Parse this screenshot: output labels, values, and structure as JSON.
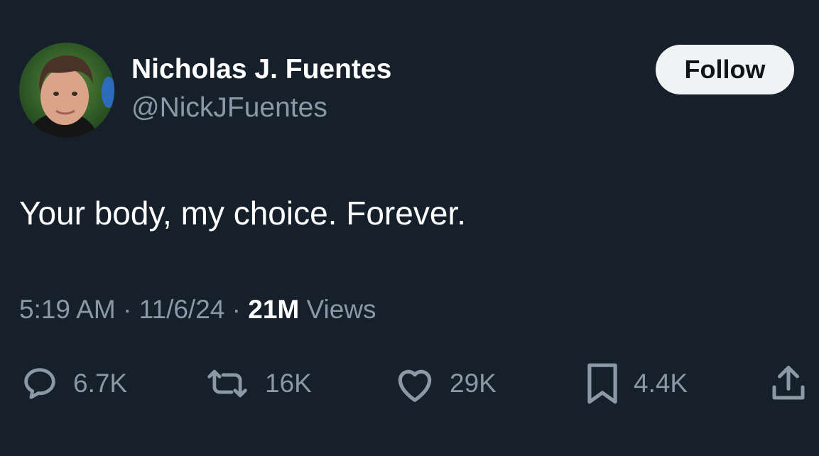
{
  "author": {
    "display_name": "Nicholas J. Fuentes",
    "handle": "@NickJFuentes"
  },
  "follow_label": "Follow",
  "tweet": {
    "text": "Your body, my choice. Forever."
  },
  "meta": {
    "time": "5:19 AM",
    "separator": "·",
    "date": "11/6/24",
    "views_count": "21M",
    "views_label": "Views"
  },
  "actions": {
    "replies": "6.7K",
    "reposts": "16K",
    "likes": "29K",
    "bookmarks": "4.4K"
  },
  "icons": {
    "reply": "reply-icon",
    "repost": "repost-icon",
    "like": "heart-icon",
    "bookmark": "bookmark-icon",
    "share": "share-icon"
  },
  "colors": {
    "background": "#15202b",
    "primary_text": "#ffffff",
    "secondary_text": "#8b98a5",
    "follow_button_bg": "#eff3f4"
  }
}
